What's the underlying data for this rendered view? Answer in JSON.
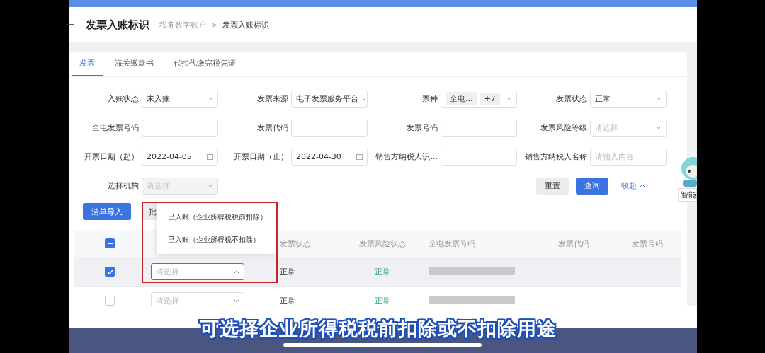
{
  "header": {
    "title": "发票入账标识",
    "breadcrumb": [
      "税务数字账户",
      "发票入账标识"
    ],
    "separator": ">"
  },
  "tabs": [
    {
      "label": "发票",
      "selected": true
    },
    {
      "label": "海关缴款书",
      "selected": false
    },
    {
      "label": "代扣代缴完税凭证",
      "selected": false
    }
  ],
  "filters": [
    {
      "label": "入账状态",
      "kind": "select",
      "value": "未入账",
      "disabled": false
    },
    {
      "label": "发票来源",
      "kind": "select",
      "value": "电子发票服务平台",
      "disabled": false
    },
    {
      "label": "票种",
      "kind": "tags",
      "tags": [
        "全电...",
        "+7"
      ],
      "disabled": false
    },
    {
      "label": "发票状态",
      "kind": "select",
      "value": "正常",
      "disabled": false
    },
    {
      "label": "全电发票号码",
      "kind": "input",
      "disabled": false
    },
    {
      "label": "发票代码",
      "kind": "input",
      "disabled": false
    },
    {
      "label": "发票号码",
      "kind": "input",
      "disabled": false
    },
    {
      "label": "发票风险等级",
      "kind": "select",
      "placeholder": "请选择",
      "disabled": false
    },
    {
      "label": "开票日期（起）",
      "kind": "date",
      "value": "2022-04-05",
      "disabled": false
    },
    {
      "label": "开票日期（止）",
      "kind": "date",
      "value": "2022-04-30",
      "disabled": false
    },
    {
      "label": "销售方纳税人识...",
      "kind": "input",
      "disabled": false
    },
    {
      "label": "销售方纳税人名称",
      "kind": "input",
      "placeholder": "请输入内容",
      "disabled": false
    },
    {
      "label": "选择机构",
      "kind": "select",
      "placeholder": "请选择",
      "disabled": true
    }
  ],
  "actions": {
    "reset": "重置",
    "query": "查询",
    "collapse": "收起"
  },
  "toolbar": {
    "import": "清单导入",
    "batch": "批"
  },
  "dropdown": {
    "options": [
      "已入账（企业所得税税前扣除）",
      "已入账（企业所得税不扣除）"
    ]
  },
  "table": {
    "select_all": {
      "indeterminate": true
    },
    "columns": [
      "发票状态",
      "发票风险状态",
      "全电发票号码",
      "发票代码",
      "发票号码"
    ],
    "rows": [
      {
        "checked": true,
        "purpose_placeholder": "请选择",
        "open": true,
        "status": "正常",
        "risk": "正常"
      },
      {
        "checked": false,
        "purpose_placeholder": "请选择",
        "open": false,
        "status": "正常",
        "risk": "正常"
      }
    ]
  },
  "assistant": {
    "label": "智能"
  },
  "caption": "可选择企业所得税税前扣除或不扣除用途"
}
